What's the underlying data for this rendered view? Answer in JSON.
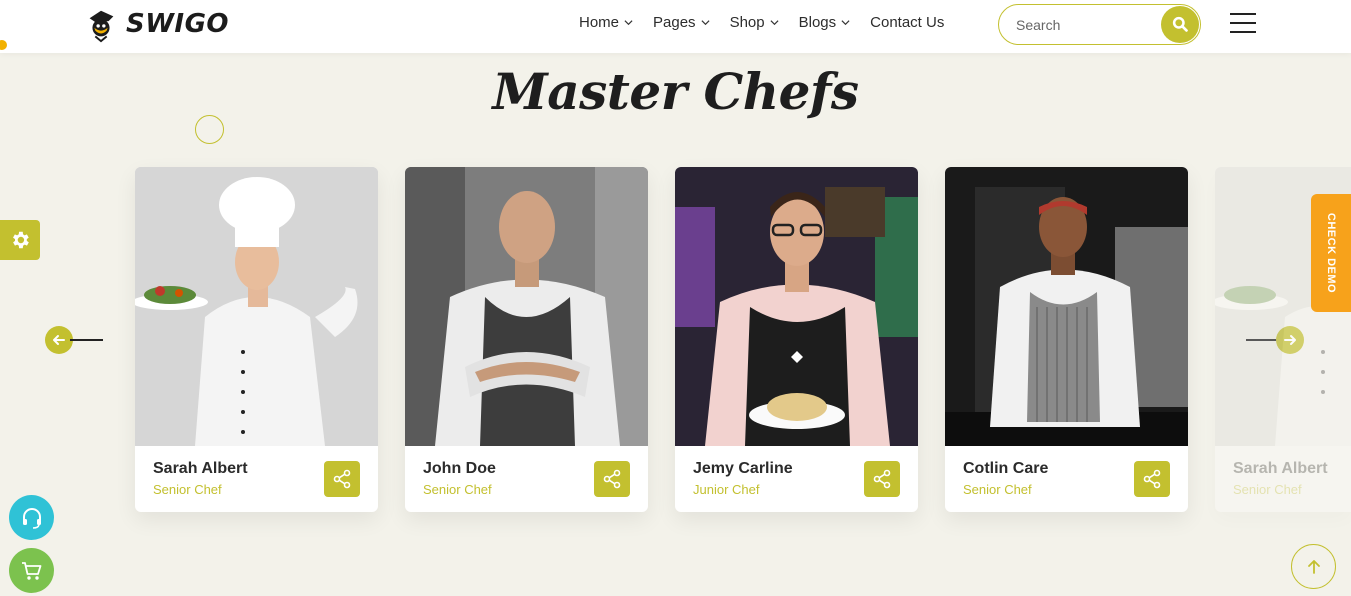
{
  "brand": {
    "name": "SWIGO"
  },
  "nav": {
    "items": [
      {
        "label": "Home",
        "has_dropdown": true
      },
      {
        "label": "Pages",
        "has_dropdown": true
      },
      {
        "label": "Shop",
        "has_dropdown": true
      },
      {
        "label": "Blogs",
        "has_dropdown": true
      },
      {
        "label": "Contact Us",
        "has_dropdown": false
      }
    ]
  },
  "search": {
    "placeholder": "Search",
    "value": ""
  },
  "section": {
    "title": "Master Chefs"
  },
  "chefs": [
    {
      "name": "Sarah Albert",
      "role": "Senior Chef"
    },
    {
      "name": "John Doe",
      "role": "Senior Chef"
    },
    {
      "name": "Jemy Carline",
      "role": "Junior Chef"
    },
    {
      "name": "Cotlin Care",
      "role": "Senior Chef"
    },
    {
      "name": "Sarah Albert",
      "role": "Senior Chef"
    }
  ],
  "widgets": {
    "check_demo": "CHECK DEMO"
  },
  "colors": {
    "accent": "#c3c02f",
    "background": "#f3f2ea",
    "demo_tab": "#f7a21b",
    "support": "#2fc2d6",
    "cart": "#7cc24e"
  },
  "icons": {
    "logo": "chef-hat-icon",
    "search": "search-icon",
    "menu": "hamburger-menu-icon",
    "share": "share-icon",
    "prev": "arrow-left-icon",
    "next": "arrow-right-icon",
    "settings": "gear-icon",
    "support": "headset-icon",
    "cart": "cart-icon",
    "scroll_top": "arrow-up-icon"
  }
}
